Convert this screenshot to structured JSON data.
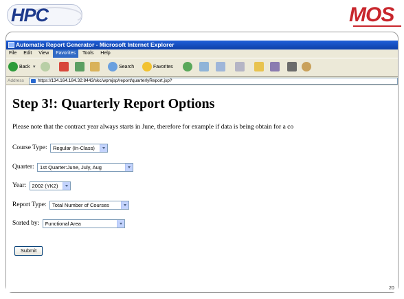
{
  "logos": {
    "left": "HPC",
    "right": "MOS"
  },
  "browser": {
    "title": "Automatic Report Generator - Microsoft Internet Explorer",
    "menu": [
      "File",
      "Edit",
      "View",
      "Favorites",
      "Tools",
      "Help"
    ],
    "active_menu_index": 3,
    "toolbar": {
      "back": "Back",
      "search": "Search",
      "favorites": "Favorites"
    },
    "address_label": "Address",
    "address_url": "https://134.164.184.32:8443/skc/wpmjsp/report/quarterlyReport.jsp?"
  },
  "page": {
    "heading": "Step 3!: Quarterly Report Options",
    "note": "Please note that the contract year always starts in June, therefore for example if data is being obtain for a co",
    "fields": {
      "course_type": {
        "label": "Course Type:",
        "value": "Regular (In-Class)"
      },
      "quarter": {
        "label": "Quarter:",
        "value": "1st Quarter:June, July, Aug"
      },
      "year": {
        "label": "Year:",
        "value": "2002 (YK2)"
      },
      "report_type": {
        "label": "Report Type:",
        "value": "Total Number of Courses"
      },
      "sorted_by": {
        "label": "Sorted by:",
        "value": "Functional Area"
      }
    },
    "submit_label": "Submit"
  },
  "slide_number": "20",
  "colors": {
    "titlebar": "#1f5fd8",
    "chrome": "#ece9d8",
    "hpc_blue": "#1e3a8c",
    "mos_red": "#c8262c"
  }
}
